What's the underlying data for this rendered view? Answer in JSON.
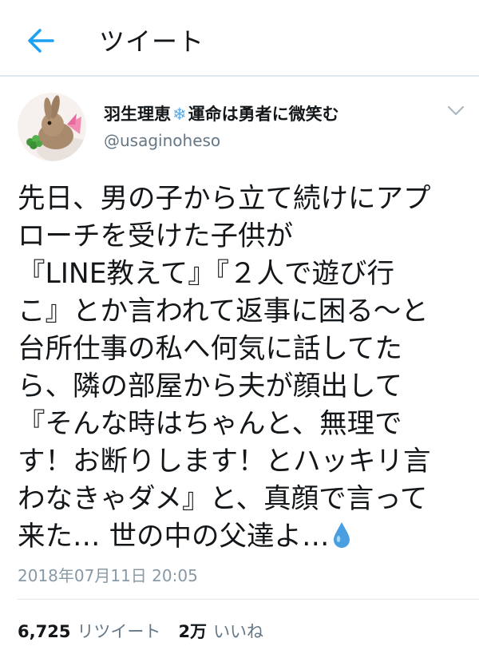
{
  "header": {
    "title": "ツイート",
    "back_icon": "arrow-left-icon"
  },
  "tweet": {
    "display_name": "羽生理恵",
    "name_suffix": "運命は勇者に微笑む",
    "name_emoji": "❄",
    "handle": "@usaginoheso",
    "text_lines": [
      "先日、男の子から立て続けにアプ",
      "ローチを受けた子供が",
      "『LINE教えて』『２人で遊び行",
      "こ』とか言われて返事に困る～と",
      "台所仕事の私へ何気に話してた",
      "ら、隣の部屋から夫が顔出して",
      "『そんな時はちゃんと、無理で",
      "す！お断りします！とハッキリ言",
      "わなきゃダメ』と、真顔で言って",
      "来た… 世の中の父達よ…"
    ],
    "timestamp": "2018年07月11日 20:05"
  },
  "stats": {
    "retweets": "6,725",
    "retweets_label": "リツイート",
    "likes": "2万",
    "likes_label": "いいね"
  },
  "colors": {
    "accent": "#1da1f2",
    "divider": "#e1e8ed",
    "secondary_text": "#657786"
  }
}
